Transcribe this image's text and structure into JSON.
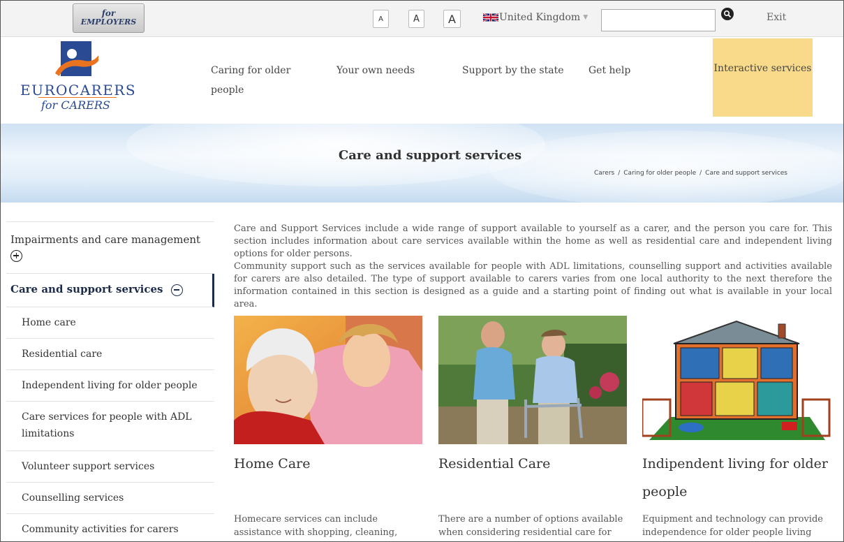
{
  "topbar": {
    "employers_line1": "for",
    "employers_line2": "EMPLOYERS",
    "font_small": "A",
    "font_medium": "A",
    "font_large": "A",
    "country": "United Kingdom",
    "search_placeholder": "",
    "exit": "Exit"
  },
  "logo": {
    "title": "EUROCARERS",
    "subtitle": "for CARERS",
    "colors": {
      "blue": "#2a4a93",
      "orange": "#e9731f"
    }
  },
  "nav": {
    "items": [
      "Caring for older people",
      "Your own needs",
      "Support by the state",
      "Get help",
      "Interactive services"
    ],
    "highlight_color": "#f9da8b"
  },
  "banner": {
    "title": "Care and support services",
    "breadcrumb": [
      "Carers",
      "Caring for older people",
      "Care and support services"
    ],
    "separator": "/"
  },
  "sidebar": {
    "top_item": "Impairments and care management",
    "active_item": "Care and support services",
    "items": [
      "Home care",
      "Residential care",
      "Independent living for older people",
      "Care services for people with ADL limitations",
      "Volunteer support services",
      "Counselling services",
      "Community activities for carers"
    ],
    "active_color": "#1c2b4a"
  },
  "intro": {
    "p1": "Care and Support Services include a wide range of support available to yourself as a carer, and the person you care for. This section includes information about care services available within the home as well as residential care and independent living options for older persons.",
    "p2": "Community support such as the services available for people with ADL limitations, counselling support and activities available for carers are also detailed. The type of support available to carers varies from one local authority to the next therefore the information contained in this section is designed as a guide and a starting point of finding out what is available in your local area."
  },
  "cards": [
    {
      "title": "Home Care",
      "text": "Homecare services can include assistance with shopping, cleaning,",
      "image": "elderly-woman-with-carer-photo"
    },
    {
      "title": "Residential Care",
      "text": "There are a number of options available when considering residential care for",
      "image": "elderly-man-with-walker-photo"
    },
    {
      "title": "Indipendent living for older people",
      "text": "Equipment and technology can provide independence for older people living",
      "image": "house-cutaway-illustration"
    }
  ]
}
